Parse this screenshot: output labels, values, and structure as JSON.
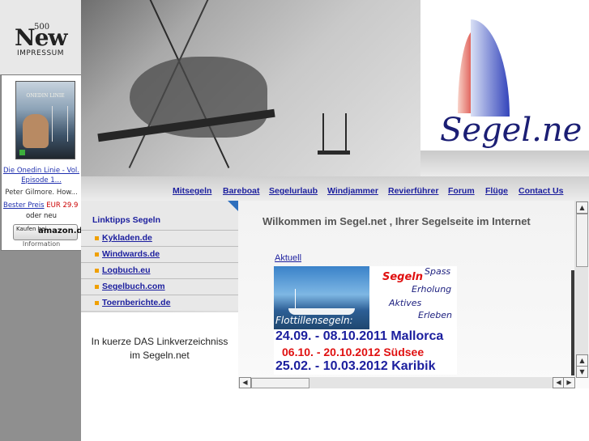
{
  "sidebar": {
    "logo": {
      "number": "500",
      "word": "New",
      "caption": "IMPRESSUM"
    },
    "ad": {
      "dvd_title": "ONEDIN LINIE",
      "title": "Die Onedin Linie - Vol. Episode 1...",
      "actor": "Peter Gilmore. How...",
      "price_link": "Bester Preis",
      "price": "EUR 29.9",
      "or_new": "oder neu",
      "amazon_button": {
        "buy_label": "Kaufen bei",
        "brand": "amazon.de"
      },
      "info": "Information"
    }
  },
  "header": {
    "logo_text": "Segel.ne"
  },
  "nav": {
    "items": [
      {
        "label": "Mitsegeln"
      },
      {
        "label": "Bareboat"
      },
      {
        "label": "Segelurlaub"
      },
      {
        "label": "Windjammer"
      },
      {
        "label": "Revierführer"
      },
      {
        "label": "Forum"
      },
      {
        "label": "Flüge"
      },
      {
        "label": "Contact Us"
      }
    ]
  },
  "links": {
    "heading": "Linktipps Segeln",
    "items": [
      {
        "label": "Kykladen.de"
      },
      {
        "label": "Windwards.de"
      },
      {
        "label": "Logbuch.eu"
      },
      {
        "label": "Segelbuch.com"
      },
      {
        "label": "Toernberichte.de"
      }
    ],
    "description_line1": "In kuerze DAS Linkverzeichniss",
    "description_line2": "im Segeln.net"
  },
  "main": {
    "heading": "Wilkommen im Segel.net , Ihrer Segelseite im Internet",
    "aktuell_link": "Aktuell",
    "banner": {
      "segeln": "Segeln",
      "spass": "Spass",
      "erholung": "Erholung",
      "aktives": "Aktives",
      "erleben": "Erleben",
      "flottillen": "Flottillensegeln:",
      "dates": [
        {
          "text": "24.09. - 08.10.2011 Mallorca",
          "color": "#1b1e9e"
        },
        {
          "text": "06.10. - 20.10.2012 Südsee",
          "color": "#e01010"
        },
        {
          "text": "25.02. - 10.03.2012 Karibik",
          "color": "#1b1e9e"
        }
      ]
    }
  },
  "scrollbars": {
    "up": "▲",
    "down": "▼",
    "left": "◀",
    "right": "▶"
  },
  "colors": {
    "link_blue": "#1b1e9e",
    "sidebar_grey": "#8f8f8f",
    "accent_orange": "#f0a000",
    "price_red": "#cc0000"
  }
}
